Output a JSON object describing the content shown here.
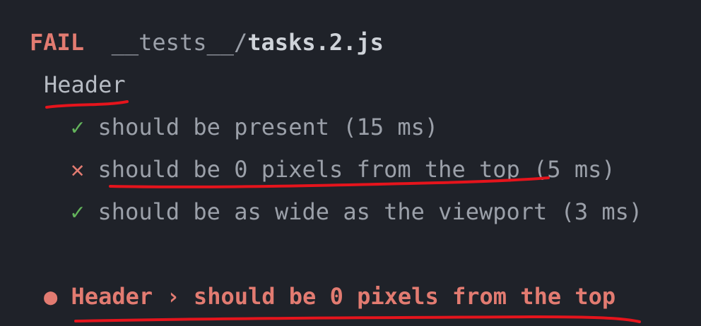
{
  "result": {
    "status": "FAIL",
    "path_dir": "__tests__/",
    "path_file": "tasks.2.js"
  },
  "suite": {
    "name": "Header",
    "tests": [
      {
        "icon": "✓",
        "icon_name": "check-icon",
        "name": "should be present",
        "time": "(15 ms)",
        "status": "pass"
      },
      {
        "icon": "✕",
        "icon_name": "cross-icon",
        "name": "should be 0 pixels from the top",
        "time": "(5 ms)",
        "status": "fail"
      },
      {
        "icon": "✓",
        "icon_name": "check-icon",
        "name": "should be as wide as the viewport",
        "time": "(3 ms)",
        "status": "pass"
      }
    ]
  },
  "error": {
    "bullet": "●",
    "title": "Header › should be 0 pixels from the top"
  },
  "colors": {
    "background": "#1f2229",
    "fail": "#e27b71",
    "pass": "#63b35b",
    "text": "#9ba0a9",
    "annotation": "#e5141c"
  }
}
